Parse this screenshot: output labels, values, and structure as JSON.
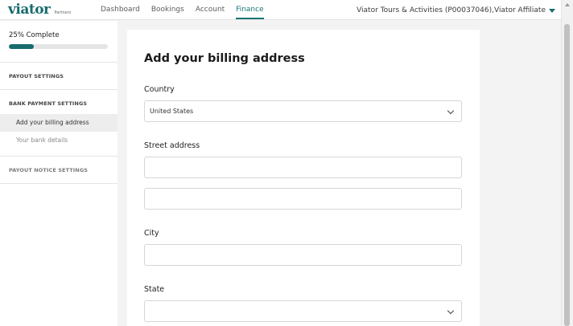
{
  "header": {
    "logo_text": "viator",
    "logo_sub": "Partners",
    "nav": [
      "Dashboard",
      "Bookings",
      "Account",
      "Finance"
    ],
    "active_nav": "Finance",
    "account_label": "Viator Tours & Activities (P00037046),Viator Affiliate",
    "brand_color": "#186b6d"
  },
  "sidebar": {
    "progress_label": "25% Complete",
    "progress_value": 0.25,
    "payout_settings": "PAYOUT SETTINGS",
    "bank_payment_settings": "BANK PAYMENT SETTINGS",
    "sub_items": [
      "Add your billing address",
      "Your bank details"
    ],
    "active_item": "Add your billing address",
    "payout_notice_settings": "PAYOUT NOTICE SETTINGS"
  },
  "form": {
    "title": "Add your billing address",
    "country_label": "Country",
    "country_value": "United States",
    "street_label": "Street address",
    "street_line1": "",
    "street_line2": "",
    "city_label": "City",
    "city_value": "",
    "state_label": "State",
    "state_value": ""
  }
}
